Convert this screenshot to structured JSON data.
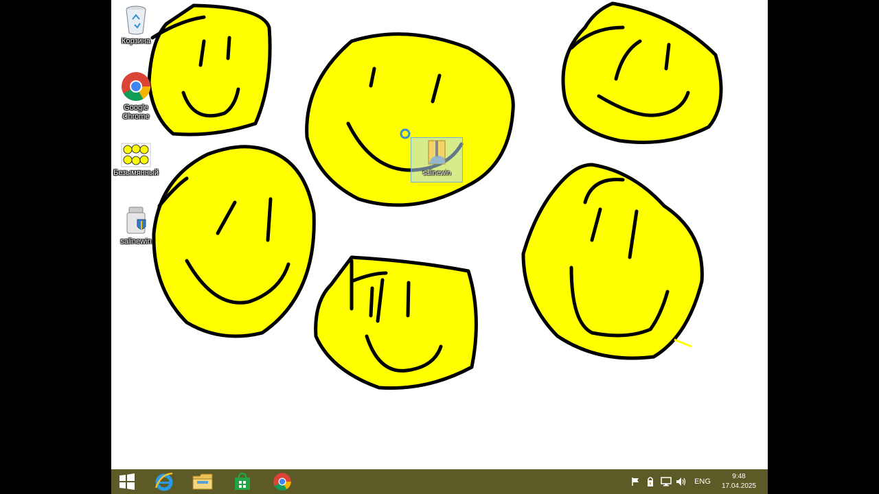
{
  "desktop": {
    "icons": [
      {
        "label": "Корзина",
        "icon": "recycle-bin-icon"
      },
      {
        "label": "Google Chrome",
        "icon": "chrome-icon"
      },
      {
        "label": "Безымянный",
        "icon": "image-file-icon"
      },
      {
        "label": "salinewin",
        "icon": "installer-icon"
      }
    ],
    "drag_ghost_label": "salinewin",
    "wallpaper_colors": {
      "face": "#ffff00",
      "outline": "#000000",
      "background": "#ffffff"
    }
  },
  "taskbar": {
    "color": "#5c5b27",
    "pinned": [
      {
        "icon": "windows-start-icon"
      },
      {
        "icon": "internet-explorer-icon"
      },
      {
        "icon": "file-explorer-icon"
      },
      {
        "icon": "store-icon"
      },
      {
        "icon": "chrome-icon"
      }
    ],
    "tray": {
      "icons": [
        "flag-icon",
        "security-icon",
        "network-icon",
        "volume-icon"
      ],
      "language": "ENG",
      "time": "9:48",
      "date": "17.04.2025"
    }
  }
}
